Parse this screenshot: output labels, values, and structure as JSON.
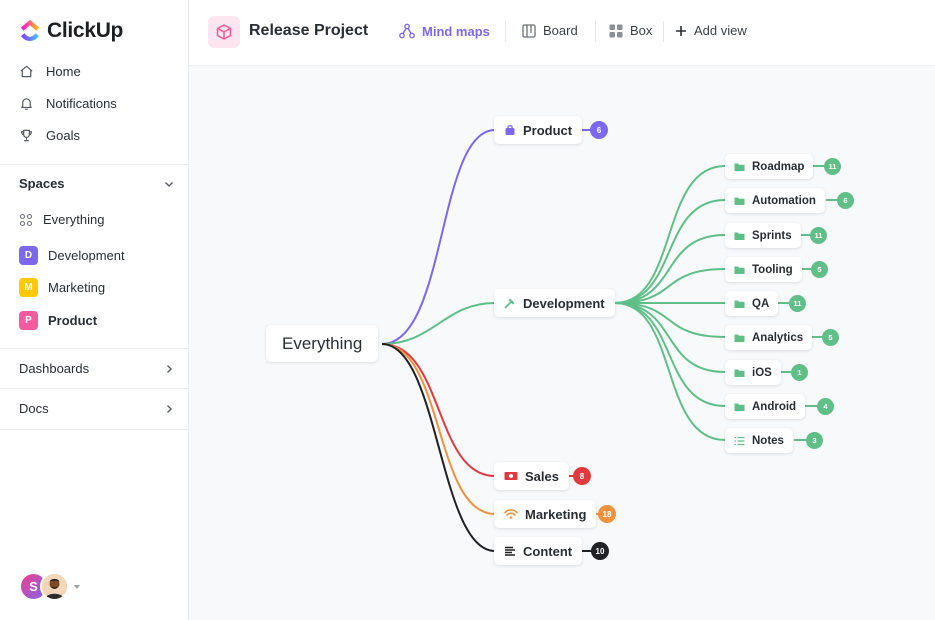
{
  "app": {
    "brand": "ClickUp"
  },
  "sidebar": {
    "nav": [
      {
        "label": "Home",
        "icon": "home-icon"
      },
      {
        "label": "Notifications",
        "icon": "bell-icon"
      },
      {
        "label": "Goals",
        "icon": "trophy-icon"
      }
    ],
    "spaces_label": "Spaces",
    "everything_label": "Everything",
    "spaces": [
      {
        "letter": "D",
        "label": "Development",
        "color": "#7b68ee"
      },
      {
        "letter": "M",
        "label": "Marketing",
        "color": "#ffc800"
      },
      {
        "letter": "P",
        "label": "Product",
        "color": "#f55a9f"
      }
    ],
    "dashboards_label": "Dashboards",
    "docs_label": "Docs",
    "avatar_initial": "S"
  },
  "header": {
    "project_title": "Release Project",
    "views": [
      {
        "label": "Mind maps",
        "icon": "mind-map-icon",
        "active": true
      },
      {
        "label": "Board",
        "icon": "board-icon",
        "active": false
      },
      {
        "label": "Box",
        "icon": "box-icon",
        "active": false
      }
    ],
    "add_view_label": "Add view"
  },
  "mindmap": {
    "root": "Everything",
    "branches": [
      {
        "label": "Product",
        "count": "6",
        "color": "#7b68ee",
        "icon": "bag-icon"
      },
      {
        "label": "Development",
        "count": "",
        "color": "#5fbf87",
        "icon": "hammer-icon"
      },
      {
        "label": "Sales",
        "count": "8",
        "color": "#e0393e",
        "icon": "money-icon"
      },
      {
        "label": "Marketing",
        "count": "18",
        "color": "#f0913b",
        "icon": "wifi-icon"
      },
      {
        "label": "Content",
        "count": "10",
        "color": "#202124",
        "icon": "text-lines-icon"
      }
    ],
    "development_children": [
      {
        "label": "Roadmap",
        "count": "11",
        "icon": "folder-icon"
      },
      {
        "label": "Automation",
        "count": "6",
        "icon": "folder-icon"
      },
      {
        "label": "Sprints",
        "count": "11",
        "icon": "folder-icon"
      },
      {
        "label": "Tooling",
        "count": "5",
        "icon": "folder-icon"
      },
      {
        "label": "QA",
        "count": "11",
        "icon": "folder-icon"
      },
      {
        "label": "Analytics",
        "count": "5",
        "icon": "folder-icon"
      },
      {
        "label": "iOS",
        "count": "1",
        "icon": "folder-icon"
      },
      {
        "label": "Android",
        "count": "4",
        "icon": "folder-icon"
      },
      {
        "label": "Notes",
        "count": "3",
        "icon": "list-icon"
      }
    ],
    "leaf_color": "#5fbf87"
  }
}
